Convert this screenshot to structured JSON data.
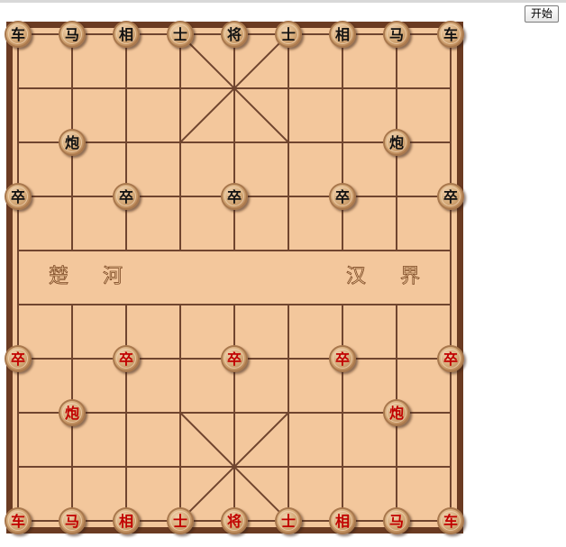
{
  "controls": {
    "start_label": "开始"
  },
  "board": {
    "colors": {
      "frame": "#6b3b22",
      "surface": "#f3c79c",
      "line": "#70452f",
      "piece_face": "#dcb383",
      "piece_rim": "#a9784d",
      "black_text": "#111111",
      "red_text": "#c10000"
    },
    "river": {
      "left": [
        "楚",
        "河"
      ],
      "right": [
        "汉",
        "界"
      ]
    },
    "pieces": [
      {
        "id": "black-rook-left",
        "side": "black",
        "label": "车",
        "file": 0,
        "rank": 0
      },
      {
        "id": "black-horse-left",
        "side": "black",
        "label": "马",
        "file": 1,
        "rank": 0
      },
      {
        "id": "black-elephant-left",
        "side": "black",
        "label": "相",
        "file": 2,
        "rank": 0
      },
      {
        "id": "black-advisor-left",
        "side": "black",
        "label": "士",
        "file": 3,
        "rank": 0
      },
      {
        "id": "black-general",
        "side": "black",
        "label": "将",
        "file": 4,
        "rank": 0
      },
      {
        "id": "black-advisor-right",
        "side": "black",
        "label": "士",
        "file": 5,
        "rank": 0
      },
      {
        "id": "black-elephant-right",
        "side": "black",
        "label": "相",
        "file": 6,
        "rank": 0
      },
      {
        "id": "black-horse-right",
        "side": "black",
        "label": "马",
        "file": 7,
        "rank": 0
      },
      {
        "id": "black-rook-right",
        "side": "black",
        "label": "车",
        "file": 8,
        "rank": 0
      },
      {
        "id": "black-cannon-left",
        "side": "black",
        "label": "炮",
        "file": 1,
        "rank": 2
      },
      {
        "id": "black-cannon-right",
        "side": "black",
        "label": "炮",
        "file": 7,
        "rank": 2
      },
      {
        "id": "black-soldier-1",
        "side": "black",
        "label": "卒",
        "file": 0,
        "rank": 3
      },
      {
        "id": "black-soldier-2",
        "side": "black",
        "label": "卒",
        "file": 2,
        "rank": 3
      },
      {
        "id": "black-soldier-3",
        "side": "black",
        "label": "卒",
        "file": 4,
        "rank": 3
      },
      {
        "id": "black-soldier-4",
        "side": "black",
        "label": "卒",
        "file": 6,
        "rank": 3
      },
      {
        "id": "black-soldier-5",
        "side": "black",
        "label": "卒",
        "file": 8,
        "rank": 3
      },
      {
        "id": "red-soldier-1",
        "side": "red",
        "label": "卒",
        "file": 0,
        "rank": 6
      },
      {
        "id": "red-soldier-2",
        "side": "red",
        "label": "卒",
        "file": 2,
        "rank": 6
      },
      {
        "id": "red-soldier-3",
        "side": "red",
        "label": "卒",
        "file": 4,
        "rank": 6
      },
      {
        "id": "red-soldier-4",
        "side": "red",
        "label": "卒",
        "file": 6,
        "rank": 6
      },
      {
        "id": "red-soldier-5",
        "side": "red",
        "label": "卒",
        "file": 8,
        "rank": 6
      },
      {
        "id": "red-cannon-left",
        "side": "red",
        "label": "炮",
        "file": 1,
        "rank": 7
      },
      {
        "id": "red-cannon-right",
        "side": "red",
        "label": "炮",
        "file": 7,
        "rank": 7
      },
      {
        "id": "red-rook-left",
        "side": "red",
        "label": "车",
        "file": 0,
        "rank": 9
      },
      {
        "id": "red-horse-left",
        "side": "red",
        "label": "马",
        "file": 1,
        "rank": 9
      },
      {
        "id": "red-elephant-left",
        "side": "red",
        "label": "相",
        "file": 2,
        "rank": 9
      },
      {
        "id": "red-advisor-left",
        "side": "red",
        "label": "士",
        "file": 3,
        "rank": 9
      },
      {
        "id": "red-general",
        "side": "red",
        "label": "将",
        "file": 4,
        "rank": 9
      },
      {
        "id": "red-advisor-right",
        "side": "red",
        "label": "士",
        "file": 5,
        "rank": 9
      },
      {
        "id": "red-elephant-right",
        "side": "red",
        "label": "相",
        "file": 6,
        "rank": 9
      },
      {
        "id": "red-horse-right",
        "side": "red",
        "label": "马",
        "file": 7,
        "rank": 9
      },
      {
        "id": "red-rook-right",
        "side": "red",
        "label": "车",
        "file": 8,
        "rank": 9
      }
    ]
  }
}
